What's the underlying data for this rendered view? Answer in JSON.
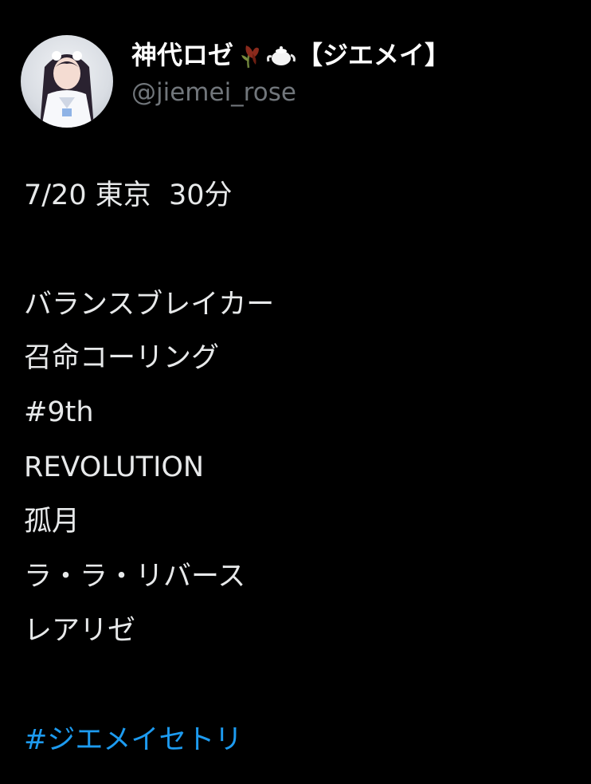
{
  "author": {
    "display_name_prefix": "神代ロゼ",
    "display_name_suffix": "【ジエメイ】",
    "emojis": [
      "wilted-rose-icon",
      "teapot-icon"
    ],
    "handle": "@jiemei_rose"
  },
  "tweet": {
    "header_line": "7/20 東京  30分",
    "setlist": [
      "バランスブレイカー",
      "召命コーリング",
      "#9th",
      "REVOLUTION",
      "孤月",
      "ラ・ラ・リバース",
      "レアリゼ"
    ],
    "hashtag": "#ジエメイセトリ"
  },
  "colors": {
    "background": "#000000",
    "text": "#e7e9ea",
    "handle": "#71767b",
    "link": "#1d9bf0"
  }
}
